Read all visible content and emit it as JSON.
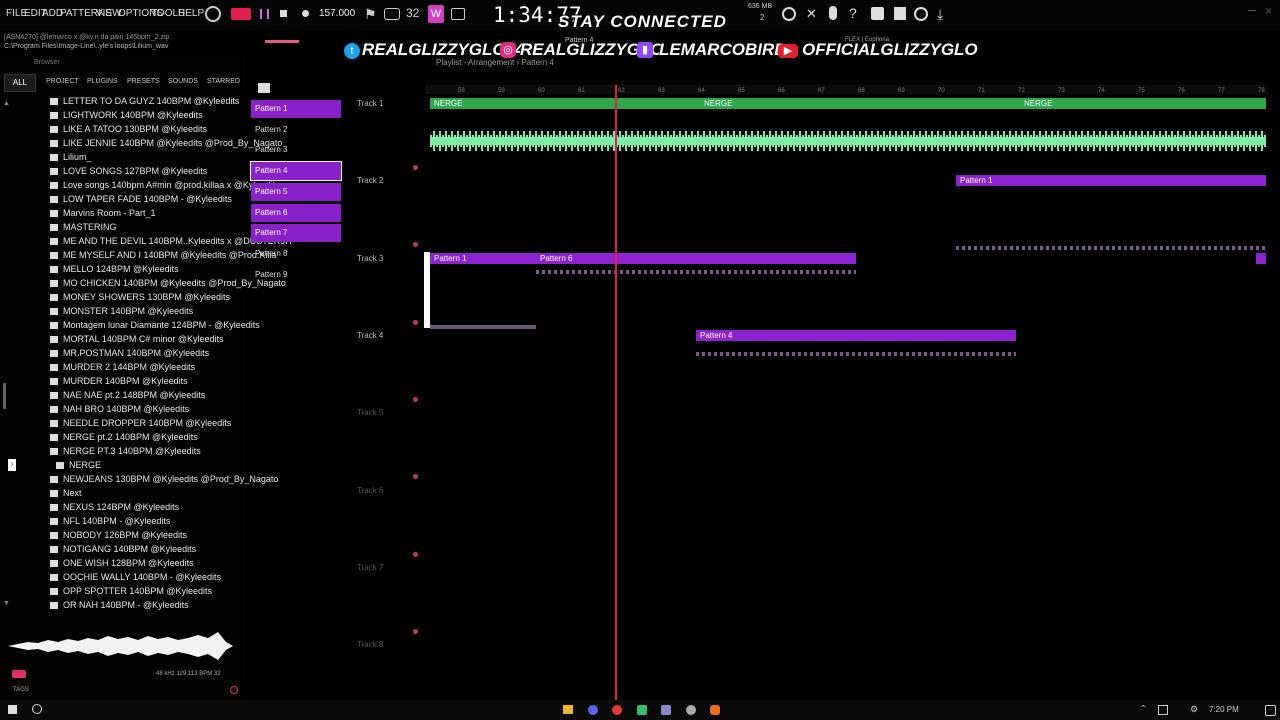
{
  "menu": [
    "FILE",
    "EDIT",
    "ADD",
    "PATTERNS",
    "VIEW",
    "OPTIONS",
    "TOOLS",
    "HELP"
  ],
  "transport": {
    "bpm": "157.000",
    "time": "1:34:77",
    "memory": "636 MB",
    "voices": "2"
  },
  "overlay": {
    "stay": "STAY CONNECTED",
    "twitter": "REALGLIZZYGLO74",
    "instagram": "REALGLIZZYGLO",
    "twitch": "LEMARCOBIRD",
    "youtube": "OFFICIALGLIZZYGLO"
  },
  "hint": {
    "line1": "[ASN4270] @lemarco x @ky.n da pain 145bpm_2.zip",
    "line2": "C:\\Program Files\\Image-Line\\..yle's loops\\Lilium_wav"
  },
  "playlist_title": "Playlist - Arrangement › Pattern 4",
  "plugin_label": "FLEX | Euphoria",
  "pattern_picker": "Pattern 4",
  "browser": {
    "title": "Browser",
    "tabs": [
      "ALL",
      "PROJECT",
      "PLUGINS",
      "PRESETS",
      "SOUNDS",
      "STARRED"
    ],
    "items": [
      "LETTER TO DA GUYZ 140BPM @Kyleedits",
      "LIGHTWORK 140BPM @Kyleedits",
      "LIKE A TATOO 130BPM @Kyleedits",
      "LIKE JENNIE 140BPM @Kyleedits @Prod_By_Nagato",
      "Lilium_",
      "LOVE SONGS 127BPM @Kyleedits",
      "Love songs 140bpm A#min @prod.killaa x @Kyleedits",
      "LOW TAPER FADE 140BPM - @Kyleedits",
      "Marvins Room - Part_1",
      "MASTERING",
      "ME AND THE DEVIL 140BPM..Kyleedits x @DUSTER9H",
      "ME MYSELF AND I 140BPM @Kyleedits @Prod.Killa",
      "MELLO 124BPM @Kyleedits",
      "MO CHICKEN 140BPM @Kyleedits @Prod_By_Nagato",
      "MONEY SHOWERS 130BPM @Kyleedits",
      "MONSTER 140BPM @Kyleedits",
      "Montagem lunar Diamante 124BPM - @Kyleedits",
      "MORTAL 140BPM C# minor @Kyleedits",
      "MR.POSTMAN 140BPM @Kyleedits",
      "MURDER 2 144BPM @Kyleedits",
      "MURDER 140BPM @Kyleedits",
      "NAE NAE pt.2 148BPM @Kyleedits",
      "NAH BRO 140BPM @Kyleedits",
      "NEEDLE DROPPER 140BPM @Kyleedits",
      "NERGE pt.2 140BPM @Kyleedits",
      "NERGE PT.3 140BPM @Kyleedits",
      "NERGE",
      "NEWJEANS 130BPM @Kyleedits @Prod_By_Nagato",
      "Next",
      "NEXUS 124BPM @Kyleedits",
      "NFL 140BPM - @Kyleedits",
      "NOBODY 126BPM @Kyleedits",
      "NOTIGANG 140BPM @Kyleedits",
      "ONE  WISH 128BPM @Kyleedits",
      "OOCHIE WALLY 140BPM - @Kyleedits",
      "OPP SPOTTER 140BPM @Kyleedits",
      "OR NAH 140BPM - @Kyleedits"
    ],
    "sample_info": "48 kHz 129.113 BPM 32",
    "tags_label": "TAGS"
  },
  "patterns": [
    "Pattern 1",
    "Pattern 2",
    "Pattern 3",
    "Pattern 4",
    "Pattern 5",
    "Pattern 6",
    "Pattern 7",
    "Pattern 8",
    "Pattern 9"
  ],
  "tracks": [
    "Track 1",
    "Track 2",
    "Track 3",
    "Track 4",
    "Track 5",
    "Track 6",
    "Track 7",
    "Track 8"
  ],
  "ruler": [
    "58",
    "59",
    "60",
    "61",
    "62",
    "63",
    "64",
    "65",
    "66",
    "67",
    "68",
    "69",
    "70",
    "71",
    "72",
    "73",
    "74",
    "75",
    "76",
    "77",
    "78"
  ],
  "clips": {
    "nerge": "NERGE",
    "p1": "Pattern 1",
    "p6": "Pattern 6",
    "p4": "Pattern 4"
  },
  "clock": "7:20 PM",
  "colors": {
    "pattern": "#8d22d0",
    "audio": "#2ea84a",
    "waveform": "#7ef0a8",
    "playhead": "#e0204a"
  }
}
